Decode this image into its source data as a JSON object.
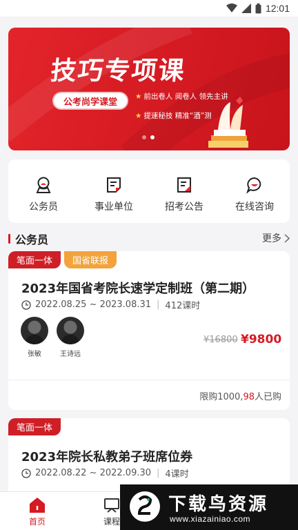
{
  "status_bar": {
    "time": "12:01"
  },
  "banner": {
    "title": "技巧专项课",
    "tag": "公考尚学课堂",
    "bullets": [
      "前出卷人 阅卷人 领先主讲",
      "提速秘技 精准“酒”测"
    ],
    "page_count": 2,
    "active_page": 2
  },
  "quick_nav": [
    {
      "label": "公务员",
      "icon": "civil-servant-icon"
    },
    {
      "label": "事业单位",
      "icon": "institution-icon"
    },
    {
      "label": "招考公告",
      "icon": "announcement-icon"
    },
    {
      "label": "在线咨询",
      "icon": "chat-icon"
    }
  ],
  "section": {
    "title": "公务员",
    "more": "更多"
  },
  "courses": [
    {
      "tags": [
        "笔面一体",
        "国省联报"
      ],
      "title": "2023年国省考院长速学定制班（第二期）",
      "dates": "2022.08.25 ~ 2023.08.31",
      "hours": "412课时",
      "teachers": [
        "张敏",
        "王诗远"
      ],
      "price_old": "¥16800",
      "price_new": "¥9800",
      "limit_prefix": "限购1000,",
      "limit_count": "98",
      "limit_suffix": "人已购"
    },
    {
      "tags": [
        "笔面一体"
      ],
      "title": "2023年院长私教弟子班席位券",
      "dates": "2022.08.22 ~ 2022.09.30",
      "hours": "4课时"
    }
  ],
  "tabbar": [
    {
      "label": "首页",
      "icon": "home-icon",
      "active": true
    },
    {
      "label": "课程",
      "icon": "course-icon",
      "active": false
    }
  ],
  "watermark": {
    "title": "下载鸟资源",
    "url": "www.xiazainiao.com"
  },
  "colors": {
    "brand_red": "#d51a22",
    "tag_orange": "#f3a33b"
  }
}
